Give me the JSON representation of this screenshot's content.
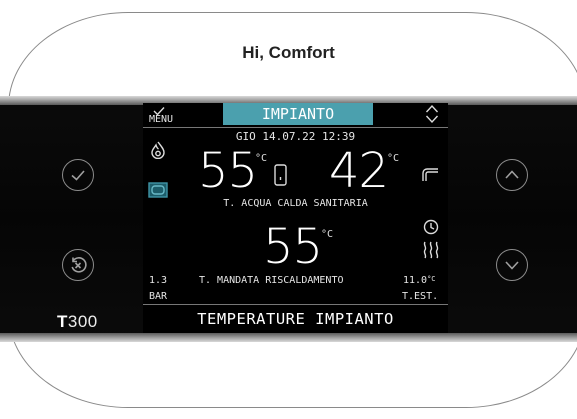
{
  "greeting": "Hi, Comfort",
  "brand": {
    "prefix": "T",
    "model": "300"
  },
  "screen": {
    "tab_label": "IMPIANTO",
    "menu_label": "MENU",
    "datetime": "GIO 14.07.22 12:39",
    "dhw_temperature": "55",
    "dhw_unit": "°C",
    "dhw_actual_temperature": "42",
    "dhw_actual_unit": "°C",
    "dhw_label": "T. ACQUA CALDA SANITARIA",
    "heating_temperature": "55",
    "heating_unit": "°C",
    "heating_label": "T. MANDATA RISCALDAMENTO",
    "pressure_value": "1.3",
    "pressure_unit": "BAR",
    "outdoor_value": "11.0",
    "outdoor_unit": "°C",
    "outdoor_label": "T.EST.",
    "footer": "TEMPERATURE IMPIANTO"
  },
  "colors": {
    "tab_accent": "#4ba0ae",
    "accent_box": "#3f94a6"
  },
  "icons": [
    "check-icon",
    "back-icon",
    "up-icon",
    "down-icon",
    "flame-icon",
    "boiler-icon",
    "tank-icon",
    "faucet-icon",
    "clock-icon",
    "heat-waves-icon",
    "up-down-icon"
  ]
}
